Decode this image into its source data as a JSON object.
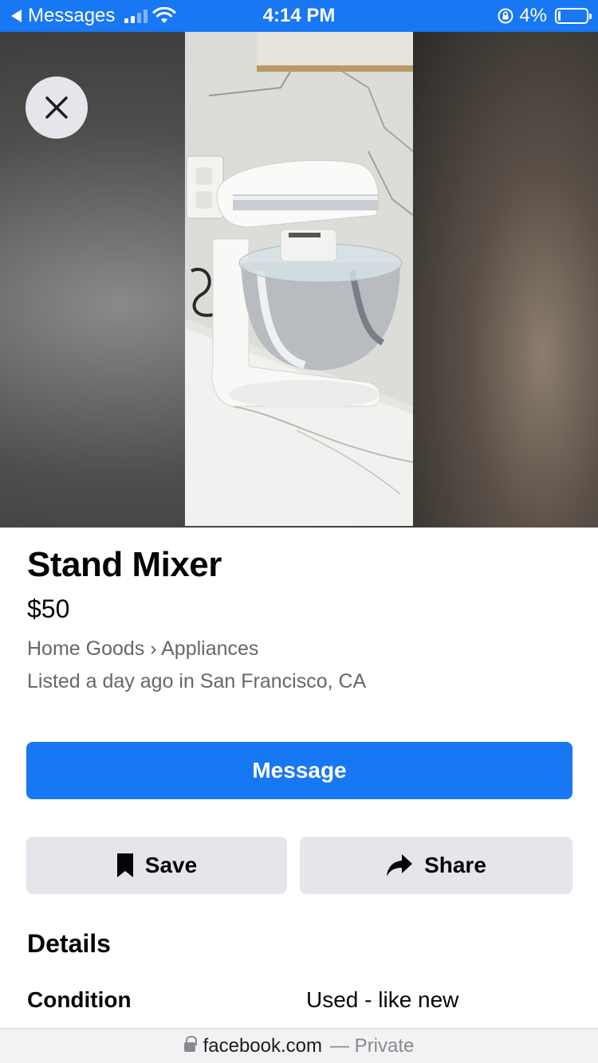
{
  "status_bar": {
    "back_app": "Messages",
    "time": "4:14 PM",
    "battery": "4%",
    "battery_level_percent": 4
  },
  "icons": {
    "close": "close-icon",
    "save": "bookmark-icon",
    "share": "share-arrow-icon",
    "lock": "lock-icon"
  },
  "listing": {
    "title": "Stand Mixer",
    "price": "$50",
    "category": "Home Goods › Appliances",
    "listed": "Listed a day ago in San Francisco, CA"
  },
  "actions": {
    "message_label": "Message",
    "save_label": "Save",
    "share_label": "Share"
  },
  "details": {
    "heading": "Details",
    "condition_label": "Condition",
    "condition_value": "Used - like new"
  },
  "url_bar": {
    "domain": "facebook.com",
    "privacy": "— Private"
  },
  "colors": {
    "brand": "#1877f2",
    "button_secondary": "#e4e6eb",
    "text_secondary": "#65676b"
  }
}
